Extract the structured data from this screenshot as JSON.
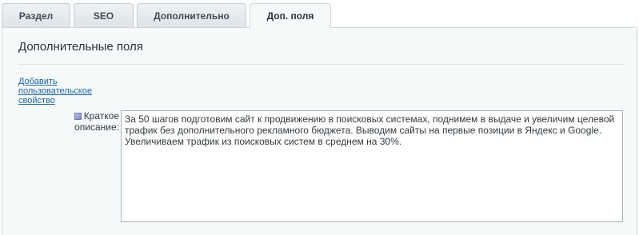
{
  "tabs": [
    {
      "label": "Раздел",
      "active": false
    },
    {
      "label": "SEO",
      "active": false
    },
    {
      "label": "Дополнительно",
      "active": false
    },
    {
      "label": "Доп. поля",
      "active": true
    }
  ],
  "panel": {
    "title": "Дополнительные поля",
    "add_link": "Добавить пользовательское свойство",
    "field": {
      "label": "Краткое описание:",
      "hint_icon": "help-icon",
      "value": "За 50 шагов подготовим сайт к продвижению в поисковых системах, поднимем в выдаче и увеличим целевой трафик без дополнительного рекламного бюджета. Выводим сайты на первые позиции в Яндекс и Google. Увеличиваем трафик из поисковых систем в среднем на 30%."
    }
  },
  "colors": {
    "link": "#2066a8",
    "panel_bg": "#f5f9f9",
    "tab_bg": "#dde4e8"
  }
}
